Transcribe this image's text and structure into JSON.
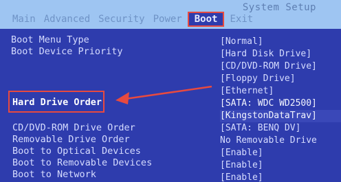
{
  "title": "System Setup",
  "tabs": [
    {
      "label": "Main",
      "active": false
    },
    {
      "label": "Advanced",
      "active": false
    },
    {
      "label": "Security",
      "active": false
    },
    {
      "label": "Power",
      "active": false
    },
    {
      "label": "Boot",
      "active": true
    },
    {
      "label": "Exit",
      "active": false
    }
  ],
  "items_top": [
    {
      "label": "Boot Menu Type"
    },
    {
      "label": "Boot Device Priority"
    }
  ],
  "highlighted_item": "Hard Drive Order",
  "items_bottom": [
    {
      "label": "CD/DVD-ROM Drive Order"
    },
    {
      "label": "Removable Drive Order"
    },
    {
      "label": "Boot to Optical Devices"
    },
    {
      "label": "Boot to Removable Devices"
    },
    {
      "label": "Boot to Network"
    }
  ],
  "values": [
    "[Normal]",
    "[Hard Disk Drive]",
    "[CD/DVD-ROM Drive]",
    "[Floppy Drive]",
    "[Ethernet]",
    "[SATA: WDC WD2500]",
    "[KingstonDataTrav]",
    "[SATA: BENQ    DV]",
    "No Removable Drive",
    "[Enable]",
    "[Enable]",
    "[Enable]"
  ],
  "colors": {
    "background": "#2e3cad",
    "menubar": "#9ec5f2",
    "annotation": "#e84a3f"
  },
  "icons": {
    "pointer": "arrow-icon"
  }
}
